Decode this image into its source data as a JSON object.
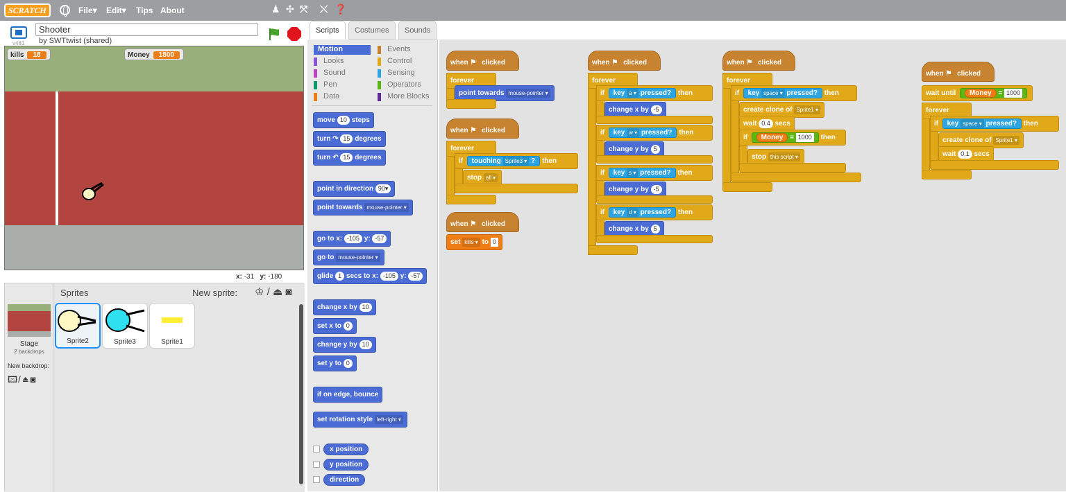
{
  "topbar": {
    "logo": "SCRATCH",
    "menus": [
      "File▾",
      "Edit▾",
      "Tips",
      "About"
    ],
    "tools": [
      "duplicate-tool",
      "grow-tool",
      "shrink-tool",
      "help-tool"
    ]
  },
  "project": {
    "title": "Shooter",
    "author": "by SWTtwist (shared)",
    "version": "v461"
  },
  "monitors": [
    {
      "label": "kills",
      "value": "18"
    },
    {
      "label": "Money",
      "value": "1800"
    }
  ],
  "stage": {
    "x_label": "x:",
    "x": "-31",
    "y_label": "y:",
    "y": "-180"
  },
  "sprite_pane": {
    "title": "Sprites",
    "new_sprite": "New sprite:",
    "stage_label": "Stage",
    "backdrops": "2 backdrops",
    "new_backdrop": "New backdrop:"
  },
  "sprites": [
    {
      "name": "Sprite2"
    },
    {
      "name": "Sprite3"
    },
    {
      "name": "Sprite1"
    }
  ],
  "tabs": [
    "Scripts",
    "Costumes",
    "Sounds"
  ],
  "categories": [
    "Motion",
    "Looks",
    "Sound",
    "Pen",
    "Data",
    "Events",
    "Control",
    "Sensing",
    "Operators",
    "More Blocks"
  ],
  "palette": {
    "move": [
      "move",
      "10",
      "steps"
    ],
    "turn_cw": [
      "turn",
      "15",
      "degrees"
    ],
    "turn_ccw": [
      "turn",
      "15",
      "degrees"
    ],
    "point_dir": [
      "point in direction",
      "90▾"
    ],
    "point_towards": [
      "point towards",
      "mouse-pointer ▾"
    ],
    "goto_xy": [
      "go to x:",
      "-105",
      "y:",
      "-57"
    ],
    "goto": [
      "go to",
      "mouse-pointer ▾"
    ],
    "glide": [
      "glide",
      "1",
      "secs to x:",
      "-105",
      "y:",
      "-57"
    ],
    "change_x": [
      "change x by",
      "10"
    ],
    "set_x": [
      "set x to",
      "0"
    ],
    "change_y": [
      "change y by",
      "10"
    ],
    "set_y": [
      "set y to",
      "0"
    ],
    "bounce": "if on edge, bounce",
    "rotation": [
      "set rotation style",
      "left-right ▾"
    ],
    "reporters": [
      "x position",
      "y position",
      "direction"
    ]
  },
  "scripts": {
    "when_clicked": [
      "when",
      "clicked"
    ],
    "forever": "forever",
    "if": "if",
    "then": "then",
    "wait": "wait",
    "secs": "secs",
    "wait_until": "wait until",
    "s1": {
      "point": "point towards",
      "target": "mouse-pointer ▾"
    },
    "s2": {
      "touching": "touching",
      "sprite": "Sprite3 ▾",
      "q": "?",
      "stop": "stop",
      "all": "all ▾"
    },
    "s3": {
      "set": "set",
      "var": "kills ▾",
      "to": "to",
      "val": "0"
    },
    "s4": {
      "key": "key",
      "pressed": "pressed?",
      "keys": [
        "a ▾",
        "w ▾",
        "s ▾",
        "d ▾"
      ],
      "actions": [
        "change x by",
        "change y by",
        "change y by",
        "change x by"
      ],
      "vals": [
        "-5",
        "5",
        "-5",
        "5"
      ]
    },
    "s5": {
      "space": "space ▾",
      "clone": "create clone of",
      "sprite": "Sprite1 ▾",
      "wait": "0.4",
      "money": "Money",
      "eq": "=",
      "amt": "1000",
      "stop": "stop",
      "this": "this script ▾"
    },
    "s6": {
      "money": "Money",
      "eq": "=",
      "amt": "1000",
      "space": "space ▾",
      "clone": "create clone of",
      "sprite": "Sprite1 ▾",
      "wait": "0.1"
    }
  }
}
